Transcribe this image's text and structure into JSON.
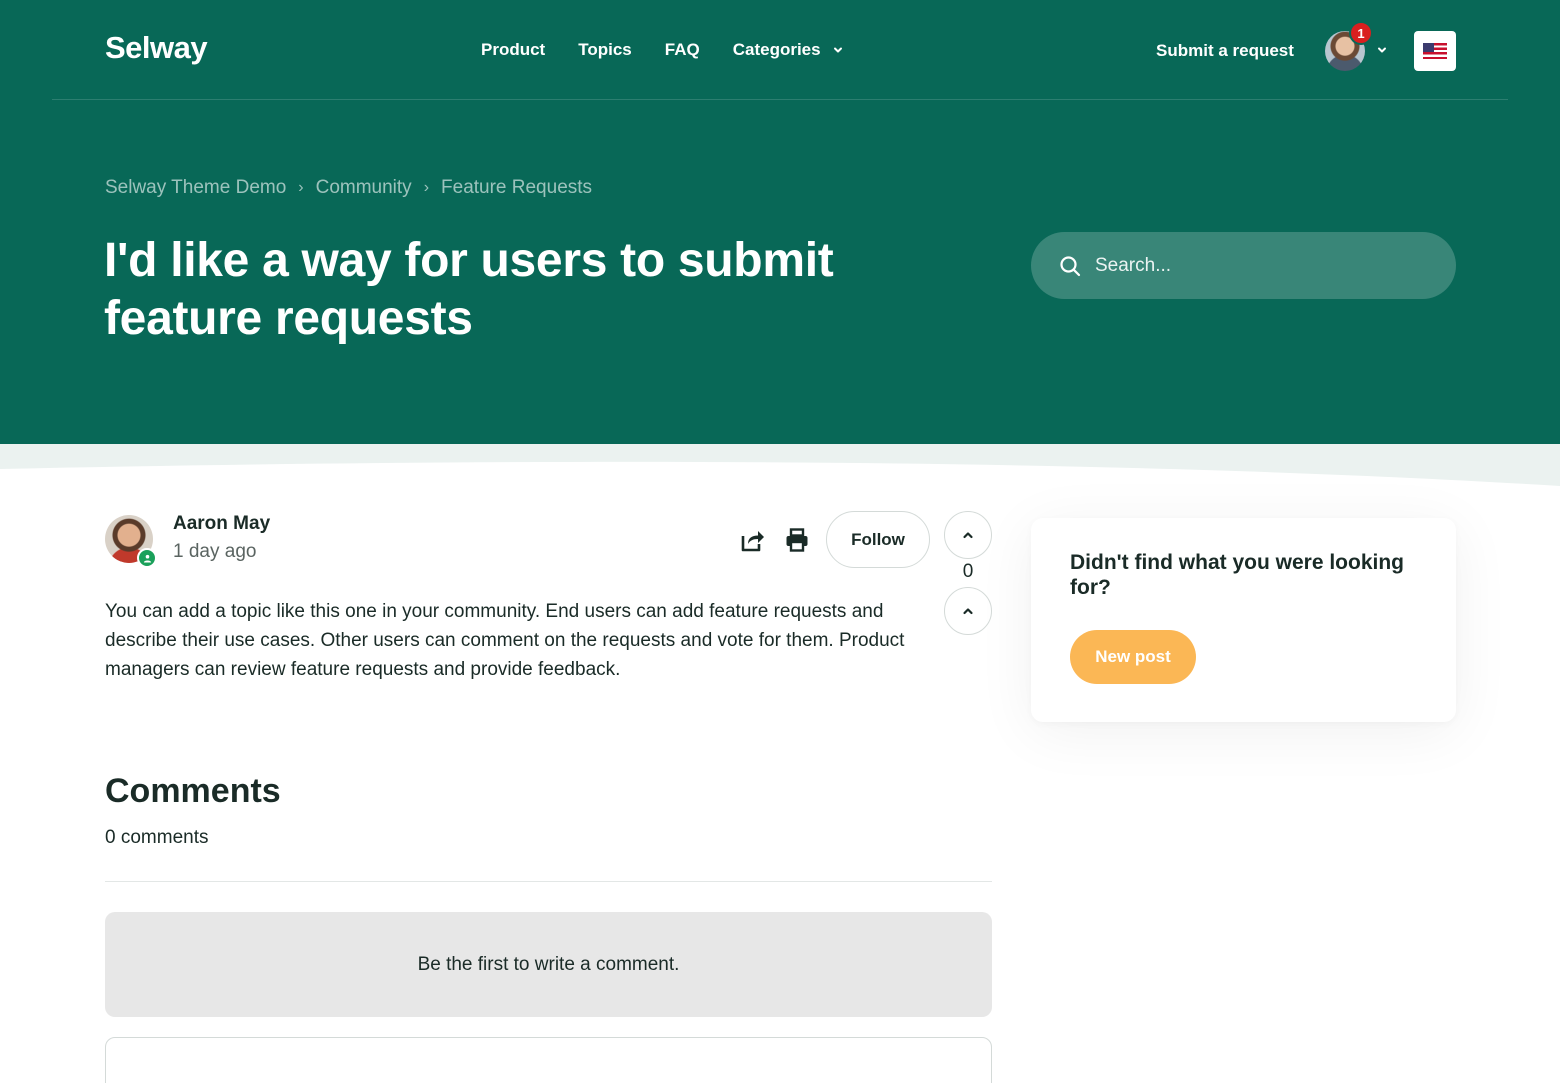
{
  "header": {
    "logo": "Selway",
    "nav": [
      {
        "label": "Product"
      },
      {
        "label": "Topics"
      },
      {
        "label": "FAQ"
      },
      {
        "label": "Categories",
        "has_dropdown": true
      }
    ],
    "submit_request": "Submit a request",
    "notification_count": "1",
    "language_icon": "us-flag-icon"
  },
  "breadcrumb": [
    "Selway Theme Demo",
    "Community",
    "Feature Requests"
  ],
  "post": {
    "title": "I'd like a way for users to submit feature requests",
    "author": "Aaron May",
    "time_ago": "1 day ago",
    "follow_label": "Follow",
    "vote_count": "0",
    "body": "You can add a topic like this one in your community. End users can add feature requests and describe their use cases. Other users can comment on the requests and vote for them. Product managers can review feature requests and provide feedback."
  },
  "search": {
    "placeholder": "Search..."
  },
  "comments": {
    "title": "Comments",
    "count_label": "0 comments",
    "empty_message": "Be the first to write a comment."
  },
  "sidebar": {
    "title": "Didn't find what you were looking for?",
    "button_label": "New post"
  },
  "colors": {
    "brand": "#086857",
    "accent": "#fbb755",
    "badge": "#d91f1f",
    "status": "#1aa05a"
  }
}
